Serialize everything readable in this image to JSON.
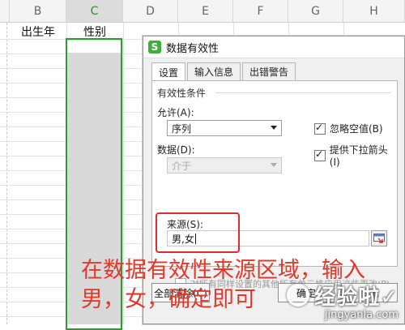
{
  "sheet": {
    "columns": [
      {
        "label": "B"
      },
      {
        "label": "C"
      },
      {
        "label": "D"
      },
      {
        "label": "E"
      },
      {
        "label": "F"
      },
      {
        "label": "G"
      },
      {
        "label": "H"
      }
    ],
    "header_row": {
      "birth_year": "出生年",
      "gender": "性别"
    },
    "selected_column": "C",
    "selection_color": "#2e9b2e"
  },
  "dialog": {
    "title": "数据有效性",
    "app_icon_letter": "S",
    "tabs": [
      {
        "label": "设置",
        "active": true
      },
      {
        "label": "输入信息",
        "active": false
      },
      {
        "label": "出错警告",
        "active": false
      }
    ],
    "group_title": "有效性条件",
    "allow_label": "允许(A):",
    "allow_value": "序列",
    "data_label": "数据(D):",
    "data_value": "介于",
    "ignore_blank_label": "忽略空值(B)",
    "ignore_blank_checked": true,
    "dropdown_label": "提供下拉箭头(I)",
    "dropdown_checked": true,
    "source_label": "来源(S):",
    "source_value": "男,女",
    "apply_all_label": "对所有同样设置的其他所有单元格应用这些更改(P)",
    "clear_all_label": "全部清除(C)",
    "ok_label": "确定",
    "cancel_label": "取消",
    "highlight_color": "#e12b2b"
  },
  "annotation": {
    "line1": "在数据有效性来源区域，输入",
    "line2": "男，女，确定即可",
    "color": "#e0392b"
  },
  "watermark": {
    "brand": "经验啦",
    "domain": "jingyanla.com",
    "check_mark": "✓"
  }
}
